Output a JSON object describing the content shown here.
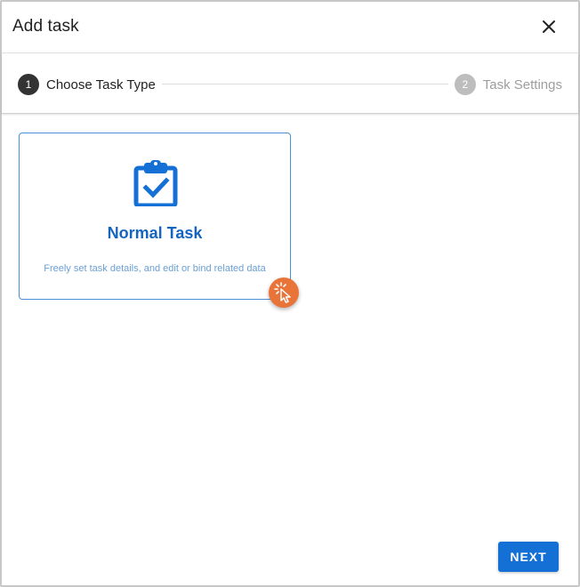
{
  "dialog": {
    "title": "Add task"
  },
  "stepper": {
    "steps": [
      {
        "number": "1",
        "label": "Choose Task Type",
        "state": "active"
      },
      {
        "number": "2",
        "label": "Task Settings",
        "state": "inactive"
      }
    ]
  },
  "task_types": [
    {
      "title": "Normal Task",
      "description": "Freely set task details, and edit or bind related data",
      "icon": "clipboard-check-icon"
    }
  ],
  "actions": {
    "next_label": "NEXT"
  },
  "colors": {
    "primary": "#1570d6",
    "card_border": "#4b8fd6",
    "card_title": "#1565c0",
    "step_active": "#333333",
    "step_inactive": "#bdbdbd",
    "click_marker": "#e9743a"
  }
}
